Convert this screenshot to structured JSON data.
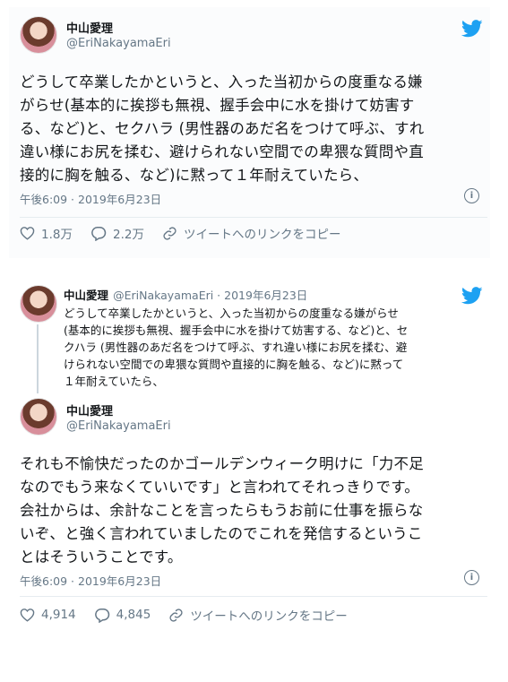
{
  "tweet1": {
    "name": "中山愛理",
    "handle": "@EriNakayamaEri",
    "text": "どうして卒業したかというと、入った当初からの度重なる嫌\nがらせ(基本的に挨拶も無視、握手会中に水を掛けて妨害す\nる、など)と、セクハラ (男性器のあだ名をつけて呼ぶ、すれ\n違い様にお尻を揉む、避けられない空間での卑猥な質問や直\n接的に胸を触る、など)に黙って１年耐えていたら、",
    "timestamp": "午後6:09 · 2019年6月23日",
    "likes": "1.8万",
    "replies": "2.2万",
    "share": "ツイートへのリンクをコピー"
  },
  "tweet2": {
    "quoted": {
      "name": "中山愛理",
      "handle": "@EriNakayamaEri · 2019年6月23日",
      "text": "どうして卒業したかというと、入った当初からの度重なる嫌がらせ\n(基本的に挨拶も無視、握手会中に水を掛けて妨害する、など)と、セ\nクハラ (男性器のあだ名をつけて呼ぶ、すれ違い様にお尻を揉む、避\nけられない空間での卑猥な質問や直接的に胸を触る、など)に黙って\n１年耐えていたら、"
    },
    "name": "中山愛理",
    "handle": "@EriNakayamaEri",
    "text": "それも不愉快だったのかゴールデンウィーク明けに「力不足\nなのでもう来なくていいです」と言われてそれっきりです。\n会社からは、余計なことを言ったらもうお前に仕事を振らな\nいぞ、と強く言われていましたのでこれを発信するというこ\nとはそういうことです。",
    "timestamp": "午後6:09 · 2019年6月23日",
    "likes": "4,914",
    "replies": "4,845",
    "share": "ツイートへのリンクをコピー"
  },
  "colors": {
    "twitter_blue": "#1da1f2",
    "text": "#14171a",
    "muted": "#657786"
  }
}
